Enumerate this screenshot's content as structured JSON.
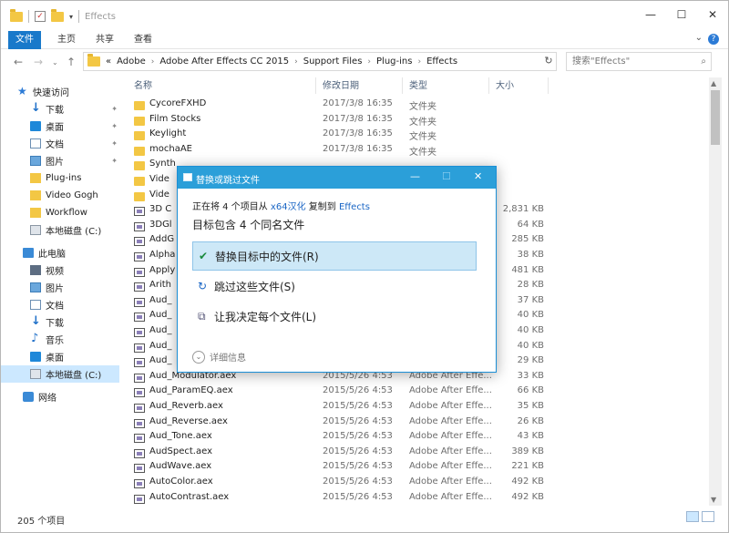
{
  "window": {
    "title": "Effects",
    "controls": {
      "minimize": "—",
      "maximize": "☐",
      "close": "✕"
    }
  },
  "ribbon": {
    "tabs": [
      "文件",
      "主页",
      "共享",
      "查看"
    ],
    "help": "?"
  },
  "address": {
    "crumbs": [
      "«",
      "Adobe",
      "Adobe After Effects CC 2015",
      "Support Files",
      "Plug-ins",
      "Effects"
    ],
    "search_placeholder": "搜索\"Effects\""
  },
  "sidebar": {
    "items": [
      {
        "label": "快速访问",
        "icon": "star-icon"
      },
      {
        "label": "下载",
        "icon": "download-icon",
        "pinned": true
      },
      {
        "label": "桌面",
        "icon": "desktop-icon",
        "pinned": true
      },
      {
        "label": "文档",
        "icon": "document-icon",
        "pinned": true
      },
      {
        "label": "图片",
        "icon": "picture-icon",
        "pinned": true
      },
      {
        "label": "Plug-ins",
        "icon": "folder-icon"
      },
      {
        "label": "Video Gogh",
        "icon": "folder-icon"
      },
      {
        "label": "Workflow",
        "icon": "folder-icon"
      },
      {
        "label": "本地磁盘 (C:)",
        "icon": "disk-icon"
      },
      {
        "label": "此电脑",
        "icon": "computer-icon"
      },
      {
        "label": "视频",
        "icon": "video-icon"
      },
      {
        "label": "图片",
        "icon": "picture-icon"
      },
      {
        "label": "文档",
        "icon": "document-icon"
      },
      {
        "label": "下载",
        "icon": "download-icon"
      },
      {
        "label": "音乐",
        "icon": "music-icon"
      },
      {
        "label": "桌面",
        "icon": "desktop-icon"
      },
      {
        "label": "本地磁盘 (C:)",
        "icon": "disk-icon",
        "selected": true
      },
      {
        "label": "网络",
        "icon": "network-icon"
      }
    ]
  },
  "columns": {
    "name": "名称",
    "date": "修改日期",
    "type": "类型",
    "size": "大小"
  },
  "files": [
    {
      "name": "CycoreFXHD",
      "date": "2017/3/8 16:35",
      "type": "文件夹",
      "size": "",
      "kind": "folder"
    },
    {
      "name": "Film Stocks",
      "date": "2017/3/8 16:35",
      "type": "文件夹",
      "size": "",
      "kind": "folder"
    },
    {
      "name": "Keylight",
      "date": "2017/3/8 16:35",
      "type": "文件夹",
      "size": "",
      "kind": "folder"
    },
    {
      "name": "mochaAE",
      "date": "2017/3/8 16:35",
      "type": "文件夹",
      "size": "",
      "kind": "folder"
    },
    {
      "name": "Synth",
      "date": "",
      "type": "",
      "size": "",
      "kind": "folder"
    },
    {
      "name": "Vide",
      "date": "",
      "type": "",
      "size": "",
      "kind": "folder"
    },
    {
      "name": "Vide",
      "date": "",
      "type": "",
      "size": "",
      "kind": "folder"
    },
    {
      "name": "3D C",
      "date": "",
      "type": "",
      "size": "2,831 KB",
      "kind": "aex"
    },
    {
      "name": "3DGl",
      "date": "",
      "type": "",
      "size": "64 KB",
      "kind": "aex"
    },
    {
      "name": "AddG",
      "date": "",
      "type": "",
      "size": "285 KB",
      "kind": "aex"
    },
    {
      "name": "Alpha",
      "date": "",
      "type": "",
      "size": "38 KB",
      "kind": "aex"
    },
    {
      "name": "Apply",
      "date": "",
      "type": "",
      "size": "481 KB",
      "kind": "aex"
    },
    {
      "name": "Arith",
      "date": "",
      "type": "",
      "size": "28 KB",
      "kind": "aex"
    },
    {
      "name": "Aud_",
      "date": "",
      "type": "",
      "size": "37 KB",
      "kind": "aex"
    },
    {
      "name": "Aud_",
      "date": "",
      "type": "",
      "size": "40 KB",
      "kind": "aex"
    },
    {
      "name": "Aud_",
      "date": "",
      "type": "",
      "size": "40 KB",
      "kind": "aex"
    },
    {
      "name": "Aud_",
      "date": "",
      "type": "",
      "size": "40 KB",
      "kind": "aex"
    },
    {
      "name": "Aud_",
      "date": "",
      "type": "",
      "size": "29 KB",
      "kind": "aex"
    },
    {
      "name": "Aud_Modulator.aex",
      "date": "2015/5/26 4:53",
      "type": "Adobe After Effe...",
      "size": "33 KB",
      "kind": "aex"
    },
    {
      "name": "Aud_ParamEQ.aex",
      "date": "2015/5/26 4:53",
      "type": "Adobe After Effe...",
      "size": "66 KB",
      "kind": "aex"
    },
    {
      "name": "Aud_Reverb.aex",
      "date": "2015/5/26 4:53",
      "type": "Adobe After Effe...",
      "size": "35 KB",
      "kind": "aex"
    },
    {
      "name": "Aud_Reverse.aex",
      "date": "2015/5/26 4:53",
      "type": "Adobe After Effe...",
      "size": "26 KB",
      "kind": "aex"
    },
    {
      "name": "Aud_Tone.aex",
      "date": "2015/5/26 4:53",
      "type": "Adobe After Effe...",
      "size": "43 KB",
      "kind": "aex"
    },
    {
      "name": "AudSpect.aex",
      "date": "2015/5/26 4:53",
      "type": "Adobe After Effe...",
      "size": "389 KB",
      "kind": "aex"
    },
    {
      "name": "AudWave.aex",
      "date": "2015/5/26 4:53",
      "type": "Adobe After Effe...",
      "size": "221 KB",
      "kind": "aex"
    },
    {
      "name": "AutoColor.aex",
      "date": "2015/5/26 4:53",
      "type": "Adobe After Effe...",
      "size": "492 KB",
      "kind": "aex"
    },
    {
      "name": "AutoContrast.aex",
      "date": "2015/5/26 4:53",
      "type": "Adobe After Effe...",
      "size": "492 KB",
      "kind": "aex"
    }
  ],
  "status": {
    "count": "205 个项目"
  },
  "dialog": {
    "title": "替换或跳过文件",
    "line1_prefix": "正在将 4 个项目从",
    "line1_source": "x64汉化",
    "line1_mid": "复制到",
    "line1_dest": "Effects",
    "line2": "目标包含 4 个同名文件",
    "options": [
      {
        "label": "替换目标中的文件(R)",
        "icon": "checkmark-icon",
        "glyph": "✔"
      },
      {
        "label": "跳过这些文件(S)",
        "icon": "skip-icon",
        "glyph": "↻"
      },
      {
        "label": "让我决定每个文件(L)",
        "icon": "compare-icon",
        "glyph": "⧉"
      }
    ],
    "details": "详细信息"
  }
}
